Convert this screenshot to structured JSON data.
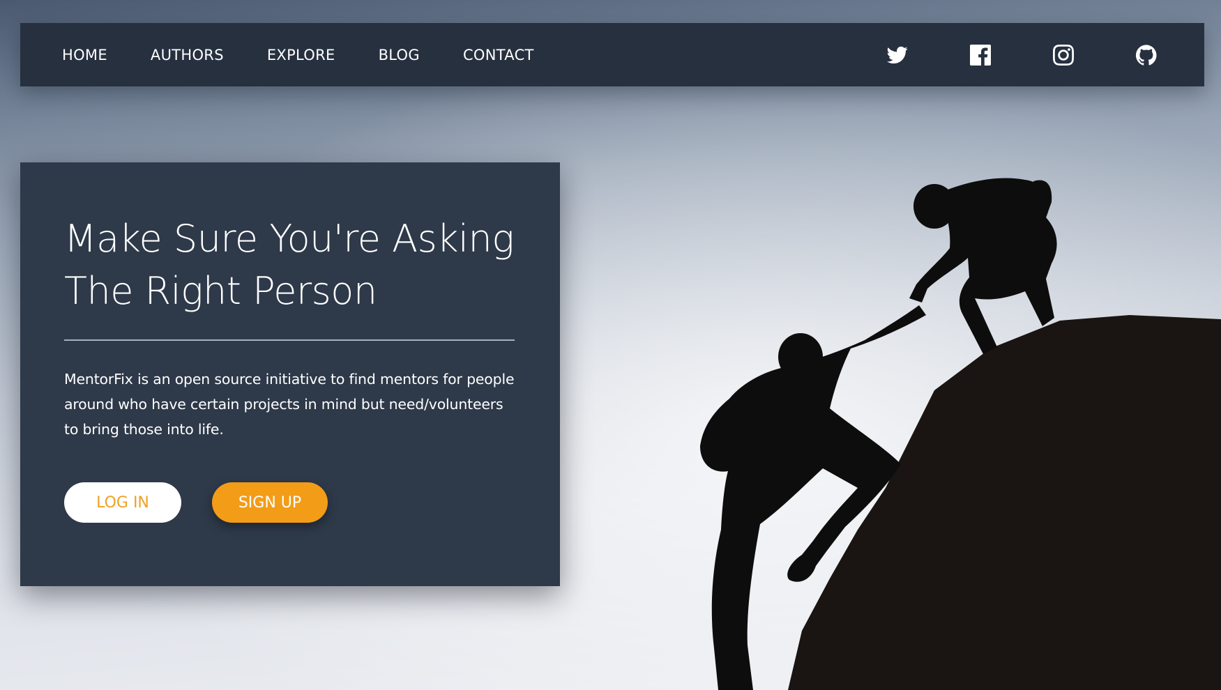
{
  "nav": {
    "links": [
      "HOME",
      "AUTHORS",
      "EXPLORE",
      "BLOG",
      "CONTACT"
    ],
    "social": [
      "twitter-icon",
      "facebook-icon",
      "instagram-icon",
      "github-icon"
    ]
  },
  "hero": {
    "title": "Make Sure You're Asking The Right Person",
    "description": "MentorFix is an open source initiative to find mentors for people around who have certain projects in mind but need/volunteers to bring those into life.",
    "login_label": "LOG IN",
    "signup_label": "SIGN UP"
  },
  "colors": {
    "nav_bg": "#26303f",
    "card_bg": "#2e3949",
    "accent": "#f39c17",
    "button_light": "#ffffff"
  }
}
